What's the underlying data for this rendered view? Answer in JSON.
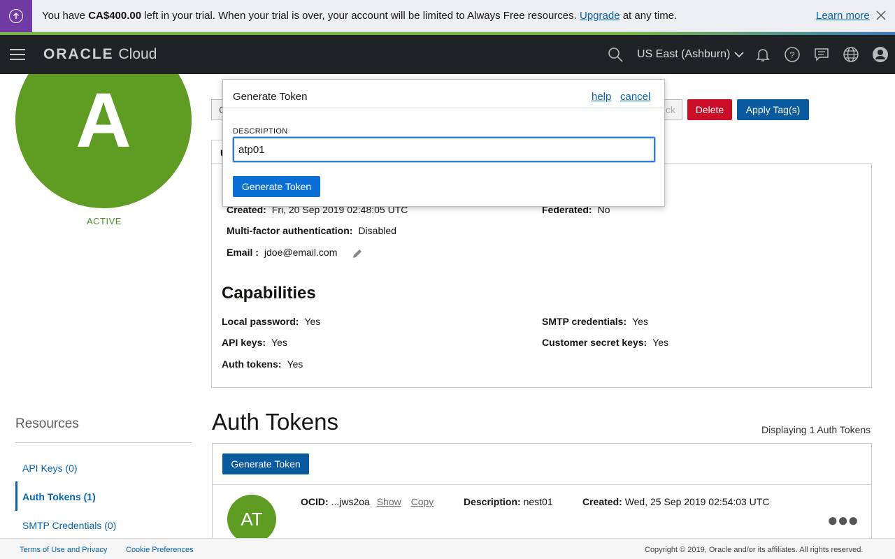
{
  "trial_banner": {
    "text_prefix": "You have ",
    "amount": "CA$400.00",
    "text_mid": " left in your trial. When your trial is over, your account will be limited to Always Free resources. ",
    "upgrade_link": "Upgrade",
    "text_suffix": " at any time.",
    "learn_more": "Learn more"
  },
  "topnav": {
    "logo_brand": "ORACLE",
    "logo_product": "Cloud",
    "region": "US East (Ashburn)",
    "icons": [
      "menu-icon",
      "search-icon",
      "chevron-down-icon",
      "bell-icon",
      "help-icon",
      "chat-icon",
      "globe-icon",
      "user-icon"
    ]
  },
  "user": {
    "avatar_letter": "A",
    "status": "ACTIVE"
  },
  "actions": {
    "delete_label": "Delete",
    "apply_tags_label": "Apply Tag(s)",
    "partial_left": "C",
    "partial_right": "ck"
  },
  "info": {
    "partial_tab": "U",
    "created_label": "Created:",
    "created_value": "Fri, 20 Sep 2019 02:48:05 UTC",
    "federated_label": "Federated:",
    "federated_value": "No",
    "mfa_label": "Multi-factor authentication:",
    "mfa_value": "Disabled",
    "email_label": "Email :",
    "email_value": "jdoe@email.com"
  },
  "capabilities": {
    "title": "Capabilities",
    "items": [
      {
        "label": "Local password:",
        "value": "Yes"
      },
      {
        "label": "SMTP credentials:",
        "value": "Yes"
      },
      {
        "label": "API keys:",
        "value": "Yes"
      },
      {
        "label": "Customer secret keys:",
        "value": "Yes"
      },
      {
        "label": "Auth tokens:",
        "value": "Yes"
      }
    ]
  },
  "resources": {
    "title": "Resources",
    "items": [
      {
        "label": "API Keys (0)",
        "active": false
      },
      {
        "label": "Auth Tokens (1)",
        "active": true
      },
      {
        "label": "SMTP Credentials (0)",
        "active": false
      }
    ]
  },
  "auth_tokens": {
    "title": "Auth Tokens",
    "count_text": "Displaying 1 Auth Tokens",
    "generate_label": "Generate Token",
    "rows": [
      {
        "avatar": "AT",
        "ocid_label": "OCID:",
        "ocid_value": "...jws2oa",
        "show": "Show",
        "copy": "Copy",
        "description_label": "Description:",
        "description_value": "nest01",
        "created_label": "Created:",
        "created_value": "Wed, 25 Sep 2019 02:54:03 UTC"
      }
    ]
  },
  "dialog": {
    "title": "Generate Token",
    "help": "help",
    "cancel": "cancel",
    "description_label": "DESCRIPTION",
    "description_value": "atp01",
    "submit_label": "Generate Token"
  },
  "footer": {
    "terms": "Terms of Use and Privacy",
    "cookies": "Cookie Preferences",
    "copyright": "Copyright © 2019, Oracle and/or its affiliates. All rights reserved."
  },
  "colors": {
    "brand_purple": "#6f3aa3",
    "nav_bg": "#202326",
    "avatar_green": "#5e9c24",
    "primary_blue": "#0a5a9f",
    "delete_red": "#cb0e27",
    "link_blue": "#0564b0"
  }
}
